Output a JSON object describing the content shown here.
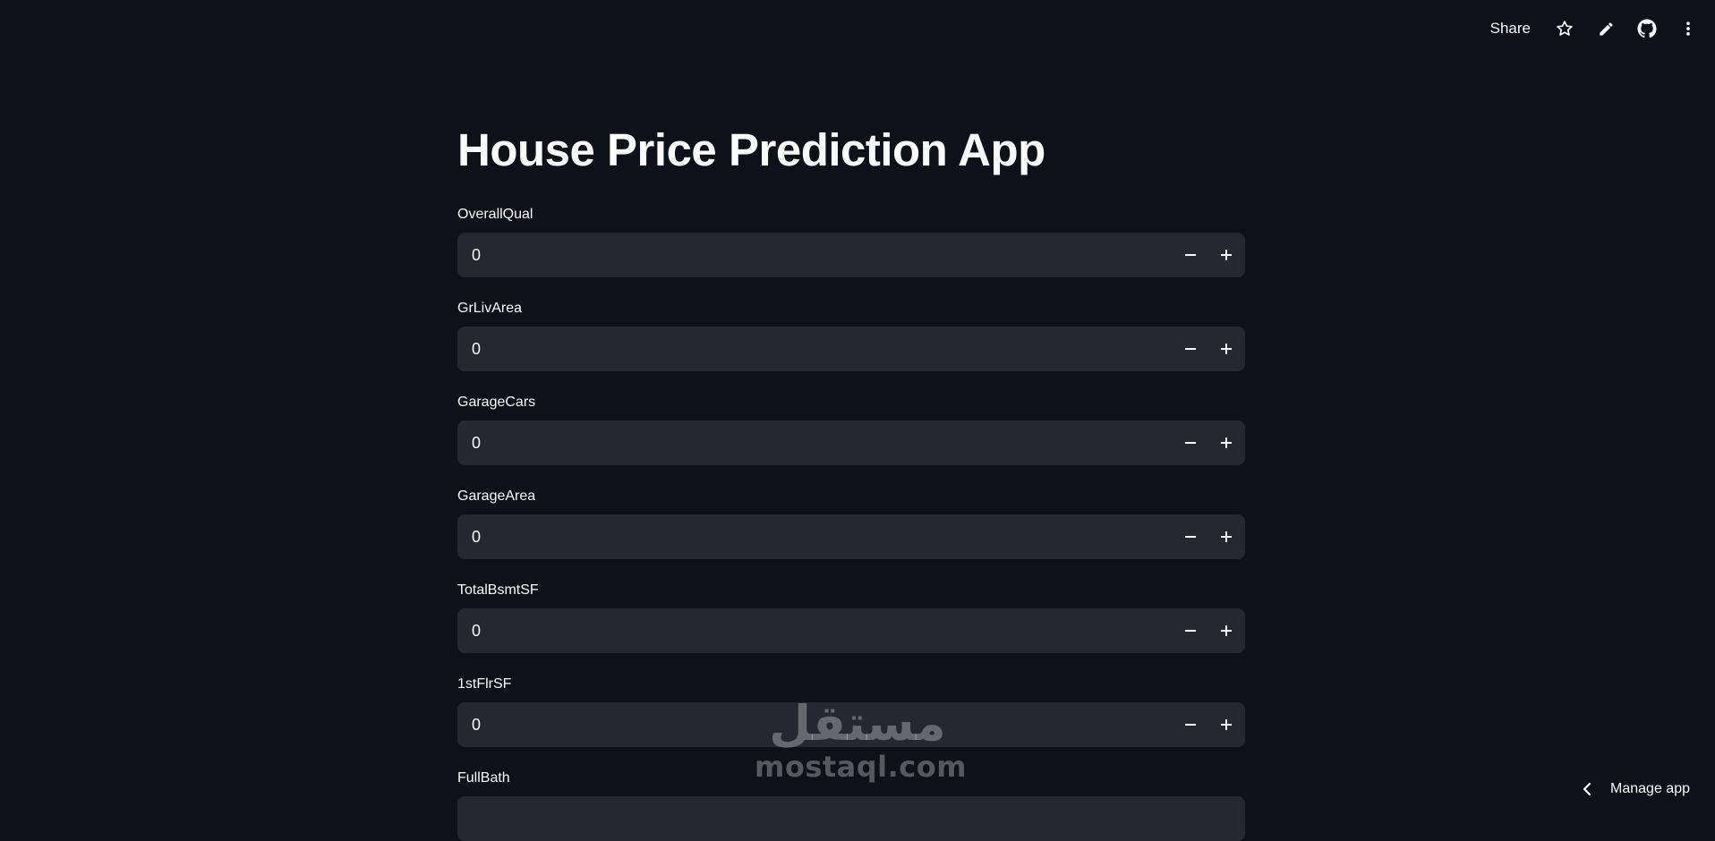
{
  "toolbar": {
    "share_label": "Share",
    "icons": [
      "star-icon",
      "pencil-icon",
      "github-icon",
      "more-vertical-icon"
    ]
  },
  "page": {
    "title": "House Price Prediction App"
  },
  "fields": [
    {
      "label": "OverallQual",
      "value": "0"
    },
    {
      "label": "GrLivArea",
      "value": "0"
    },
    {
      "label": "GarageCars",
      "value": "0"
    },
    {
      "label": "GarageArea",
      "value": "0"
    },
    {
      "label": "TotalBsmtSF",
      "value": "0"
    },
    {
      "label": "1stFlrSF",
      "value": "0"
    },
    {
      "label": "FullBath",
      "value": ""
    }
  ],
  "watermark": {
    "arabic": "مستقل",
    "latin": "mostaql.com"
  },
  "manage_app": {
    "label": "Manage app"
  },
  "colors": {
    "background": "#0e1117",
    "input_bg": "#262730",
    "text": "#fafafa"
  }
}
